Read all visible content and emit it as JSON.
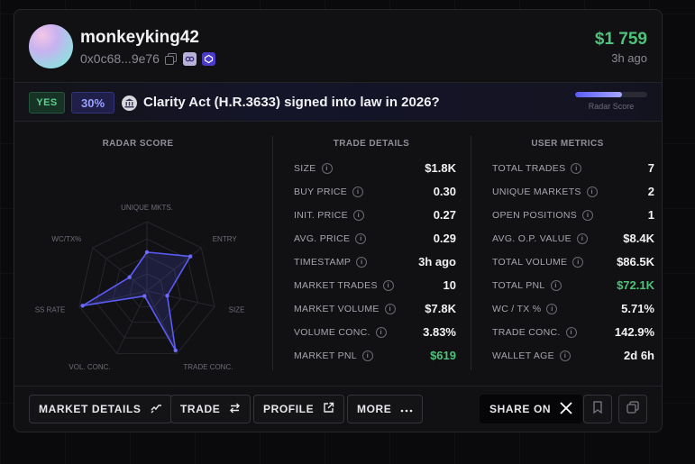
{
  "header": {
    "username": "monkeyking42",
    "wallet": "0x0c68...9e76",
    "amount": "$1 759",
    "time_ago": "3h ago"
  },
  "market": {
    "side": "YES",
    "probability": "30%",
    "title": "Clarity Act (H.R.3633) signed into law in 2026?",
    "radar_score_label": "Radar Score",
    "radar_score_fraction": 0.65
  },
  "radar": {
    "title": "RADAR SCORE",
    "axes": [
      "UNIQUE MKTS.",
      "ENTRY",
      "SIZE",
      "TRADE CONC.",
      "VOL. CONC.",
      "SS RATE",
      "WC/TX%"
    ],
    "values": [
      0.56,
      0.8,
      0.3,
      0.95,
      0.08,
      0.95,
      0.32
    ]
  },
  "trade_details": {
    "title": "TRADE DETAILS",
    "rows": [
      {
        "label": "SIZE",
        "value": "$1.8K"
      },
      {
        "label": "BUY PRICE",
        "value": "0.30"
      },
      {
        "label": "INIT. PRICE",
        "value": "0.27"
      },
      {
        "label": "AVG. PRICE",
        "value": "0.29"
      },
      {
        "label": "TIMESTAMP",
        "value": "3h ago"
      },
      {
        "label": "MARKET TRADES",
        "value": "10"
      },
      {
        "label": "MARKET VOLUME",
        "value": "$7.8K"
      },
      {
        "label": "VOLUME CONC.",
        "value": "3.83%"
      },
      {
        "label": "MARKET PNL",
        "value": "$619"
      }
    ]
  },
  "user_metrics": {
    "title": "USER METRICS",
    "rows": [
      {
        "label": "TOTAL TRADES",
        "value": "7"
      },
      {
        "label": "UNIQUE MARKETS",
        "value": "2"
      },
      {
        "label": "OPEN POSITIONS",
        "value": "1"
      },
      {
        "label": "AVG. O.P. VALUE",
        "value": "$8.4K"
      },
      {
        "label": "TOTAL VOLUME",
        "value": "$86.5K"
      },
      {
        "label": "TOTAL PNL",
        "value": "$72.1K"
      },
      {
        "label": "WC / TX %",
        "value": "5.71%"
      },
      {
        "label": "TRADE CONC.",
        "value": "142.9%"
      },
      {
        "label": "WALLET AGE",
        "value": "2d 6h"
      }
    ]
  },
  "footer": {
    "market_details": "MARKET DETAILS",
    "trade": "TRADE",
    "profile": "PROFILE",
    "more": "MORE",
    "share_on": "SHARE ON"
  },
  "colors": {
    "accent": "#5b5bf5",
    "positive": "#4ec27a"
  },
  "icons": [
    "copy-icon",
    "link-icon",
    "polygon-icon",
    "chart-icon",
    "swap-icon",
    "external-link-icon",
    "ellipsis-icon",
    "x-logo-icon",
    "bookmark-icon",
    "duplicate-icon"
  ]
}
